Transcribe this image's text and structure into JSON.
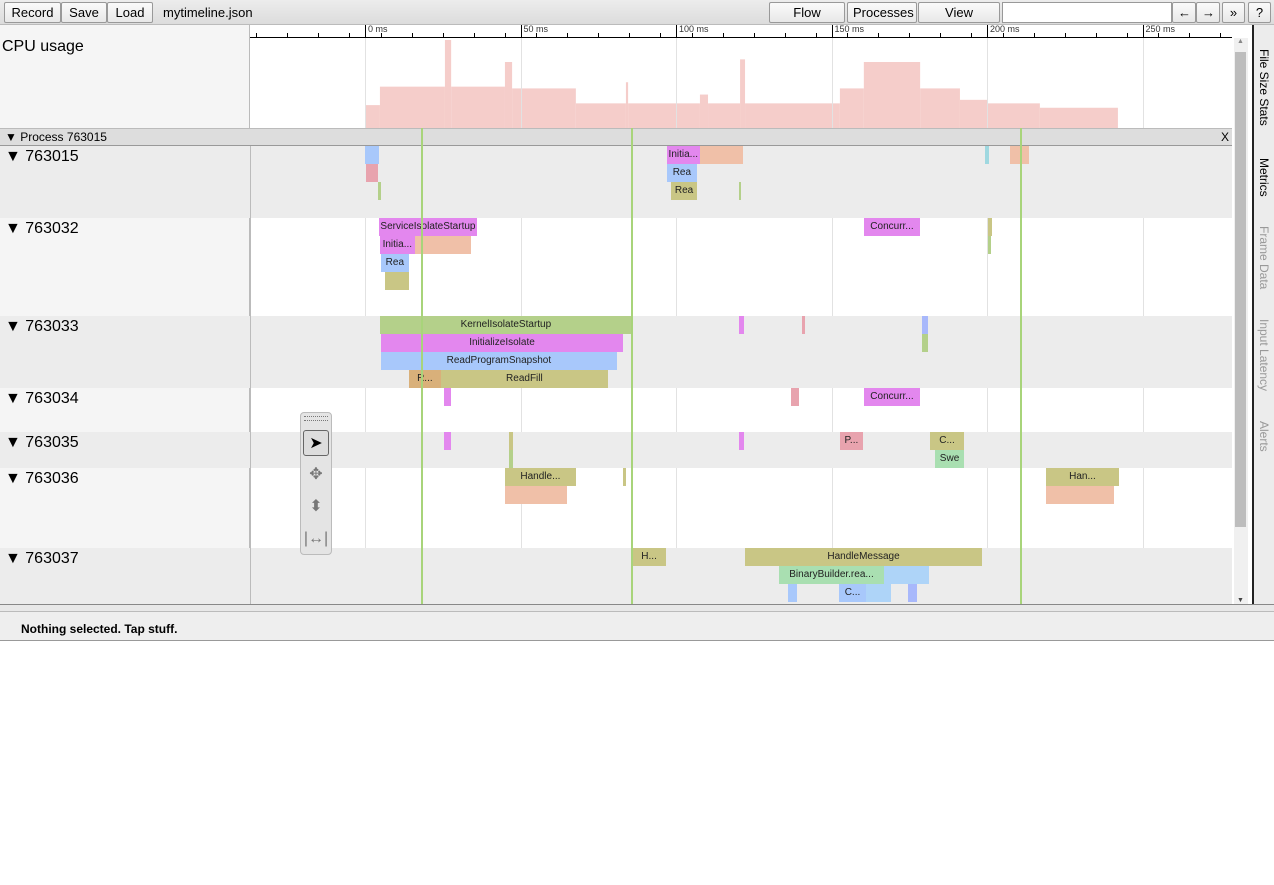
{
  "toolbar": {
    "record": "Record",
    "save": "Save",
    "load": "Load",
    "filename": "mytimeline.json",
    "flow_events": "Flow events",
    "processes": "Processes",
    "view_options": "View Options",
    "search_value": "",
    "prev": "←",
    "next": "→",
    "more": "»",
    "help": "?"
  },
  "ruler": {
    "ticks": [
      "0 ms",
      "50 ms",
      "100 ms",
      "150 ms",
      "200 ms",
      "250 ms"
    ]
  },
  "cpu": {
    "label": "CPU usage",
    "color": "#f5cdca",
    "steps": [
      [
        0,
        26
      ],
      [
        4.8,
        47
      ],
      [
        25.7,
        100
      ],
      [
        27.7,
        47
      ],
      [
        45,
        75
      ],
      [
        47.3,
        45
      ],
      [
        67.8,
        28
      ],
      [
        83.9,
        52
      ],
      [
        84.6,
        28
      ],
      [
        107.7,
        38
      ],
      [
        110.3,
        28
      ],
      [
        120.6,
        78
      ],
      [
        122.2,
        28
      ],
      [
        152.7,
        45
      ],
      [
        160.4,
        75
      ],
      [
        178.5,
        45
      ],
      [
        191.3,
        32
      ],
      [
        200.3,
        28
      ],
      [
        217,
        23
      ],
      [
        242.1,
        0
      ]
    ]
  },
  "process": {
    "title": "▼ Process 763015",
    "close": "X"
  },
  "tracks": [
    {
      "label": "▼ 763015",
      "slices": [
        [
          0,
          4.5,
          0,
          "",
          "#a8c8fb"
        ],
        [
          0.3,
          4,
          1,
          "",
          "#e8a3ae"
        ],
        [
          4.3,
          0.7,
          2,
          "",
          "#b4d08a"
        ],
        [
          97,
          10.7,
          0,
          "Initia...",
          "#e387ee"
        ],
        [
          107.7,
          14,
          0,
          "",
          "#f0c0a8"
        ],
        [
          97,
          9.8,
          1,
          "Rea",
          "#a8c8fb"
        ],
        [
          98.4,
          8.4,
          2,
          "Rea",
          "#c9c685"
        ],
        [
          120.3,
          0.6,
          2,
          "",
          "#b4d08a"
        ],
        [
          199.5,
          1.2,
          0,
          "",
          "#9fd8e0"
        ],
        [
          207.5,
          6,
          0,
          "",
          "#f0c0a8"
        ]
      ]
    },
    {
      "label": "▼ 763032",
      "slices": [
        [
          4.5,
          31.5,
          0,
          "ServiceIsolateStartup",
          "#e387ee"
        ],
        [
          4.8,
          11.2,
          1,
          "Initia...",
          "#e387ee"
        ],
        [
          16,
          18,
          1,
          "",
          "#f0c0a8"
        ],
        [
          5.1,
          9,
          2,
          "Rea",
          "#a8c8fb"
        ],
        [
          6.4,
          7.7,
          3,
          "",
          "#c9c685"
        ],
        [
          160.4,
          18.1,
          0,
          "Concurr...",
          "#e387ee"
        ],
        [
          200.4,
          1.2,
          0,
          "",
          "#c9c685"
        ],
        [
          200.4,
          1,
          1,
          "",
          "#b4d08a"
        ]
      ]
    },
    {
      "label": "▼ 763033",
      "slices": [
        [
          4.8,
          81,
          0,
          "KernelIsolateStartup",
          "#b4d08a"
        ],
        [
          5.1,
          77.9,
          1,
          "InitializeIsolate",
          "#e387ee"
        ],
        [
          5.1,
          75.9,
          2,
          "ReadProgramSnapshot",
          "#a8c8fb"
        ],
        [
          14.1,
          10.3,
          3,
          "R...",
          "#d9b07a"
        ],
        [
          24.4,
          53.7,
          3,
          "ReadFill",
          "#c9c685"
        ],
        [
          120.3,
          1.5,
          0,
          "",
          "#e387ee"
        ],
        [
          140.5,
          1,
          0,
          "",
          "#e8a3ae"
        ],
        [
          179,
          1.9,
          0,
          "",
          "#a8b8fb"
        ],
        [
          179,
          1.9,
          1,
          "",
          "#b4d08a"
        ]
      ]
    },
    {
      "label": "▼ 763034",
      "slices": [
        [
          25.4,
          2.3,
          0,
          "",
          "#e387ee"
        ],
        [
          137,
          2.5,
          0,
          "",
          "#e8a3ae"
        ],
        [
          160.4,
          18.1,
          0,
          "Concurr...",
          "#e387ee"
        ]
      ]
    },
    {
      "label": "▼ 763035",
      "slices": [
        [
          25.4,
          2.3,
          0,
          "",
          "#e387ee"
        ],
        [
          46.3,
          1.3,
          0,
          "",
          "#c9c685"
        ],
        [
          46.3,
          1.3,
          1,
          "",
          "#b4d08a"
        ],
        [
          120.3,
          1.5,
          0,
          "",
          "#e387ee"
        ],
        [
          152.7,
          7.4,
          0,
          "P...",
          "#e8a3ae"
        ],
        [
          181.7,
          10.9,
          0,
          "C...",
          "#c9c685"
        ],
        [
          183.3,
          9.3,
          1,
          "Swe",
          "#a9dfb1"
        ]
      ]
    },
    {
      "label": "▼ 763036",
      "slices": [
        [
          45,
          22.8,
          0,
          "Handle...",
          "#c9c685"
        ],
        [
          45,
          20,
          1,
          "",
          "#f0c0a8"
        ],
        [
          83,
          1,
          0,
          "",
          "#c9c685"
        ],
        [
          219,
          23.4,
          0,
          "Han...",
          "#c9c685"
        ],
        [
          219,
          22,
          1,
          "",
          "#f0c0a8"
        ]
      ]
    },
    {
      "label": "▼ 763037",
      "slices": [
        [
          85.9,
          10.9,
          0,
          "H...",
          "#c9c685"
        ],
        [
          122.2,
          76.2,
          0,
          "HandleMessage",
          "#c9c685"
        ],
        [
          133.1,
          33.8,
          1,
          "BinaryBuilder.rea...",
          "#a9dfb1"
        ],
        [
          167,
          14.5,
          1,
          "",
          "#aed4f8"
        ],
        [
          152.4,
          8.7,
          2,
          "C...",
          "#a8c8fb"
        ],
        [
          161.1,
          8,
          2,
          "",
          "#aed4f8"
        ],
        [
          136,
          3,
          2,
          "",
          "#a8c8fb"
        ],
        [
          174.5,
          3,
          2,
          "",
          "#a8b8fb"
        ]
      ]
    }
  ],
  "markers_ms": [
    18.3,
    85.8,
    210.9
  ],
  "side_tabs": [
    "File Size Stats",
    "Metrics",
    "Frame Data",
    "Input Latency",
    "Alerts"
  ],
  "analysis": {
    "status": "Nothing selected. Tap stuff."
  }
}
